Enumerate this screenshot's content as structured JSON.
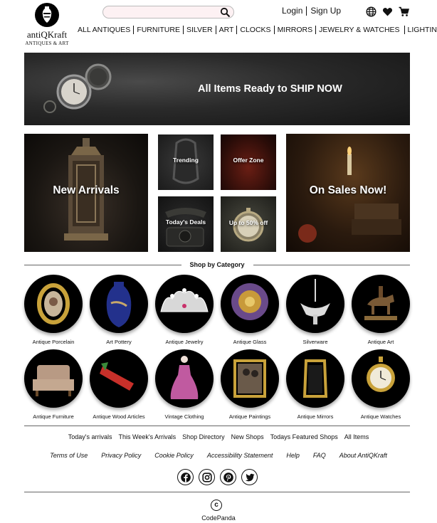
{
  "header": {
    "brand_name": "antiQKraft",
    "brand_tagline": "ANTIQUES & ART",
    "search": {
      "placeholder": "",
      "value": "",
      "icon": "search-icon"
    },
    "auth": {
      "login": "Login",
      "signup": "Sign Up"
    },
    "icons": [
      "globe-icon",
      "heart-icon",
      "cart-icon"
    ],
    "nav": [
      "ALL ANTIQUES",
      "FURNITURE",
      "SILVER",
      "ART",
      "CLOCKS",
      "MIRRORS",
      "JEWELRY & WATCHES",
      "LIGHTING"
    ]
  },
  "hero": {
    "text": "All Items Ready to SHIP NOW"
  },
  "tiles": {
    "new_arrivals": "New Arrivals",
    "trending": "Trending",
    "offer_zone": "Offer Zone",
    "todays_deals": "Today's Deals",
    "up_to_50": "Up to 50% off",
    "on_sales": "On Sales Now!"
  },
  "categories": {
    "title": "Shop by Category",
    "items": [
      "Antique Porcelain",
      "Art Pottery",
      "Antique Jewelry",
      "Antique Glass",
      "Silverware",
      "Antique Art",
      "Antique Furniture",
      "Antique Wood Articles",
      "Vintage Clothing",
      "Antique Paintings",
      "Antique Mirrors",
      "Antique Watches"
    ]
  },
  "footer": {
    "links_row1": [
      "Today's arrivals",
      "This Week's Arrivals",
      "Shop Directory",
      "New Shops",
      "Todays Featured Shops",
      "All Items"
    ],
    "links_row2": [
      "Terms of Use",
      "Privacy Policy",
      "Cookie Policy",
      "Accessibility Statement",
      "Help",
      "FAQ",
      "About AntiQKraft"
    ],
    "social": [
      "facebook-icon",
      "instagram-icon",
      "pinterest-icon",
      "twitter-icon"
    ],
    "copyright_symbol": "c",
    "brand": "CodePanda"
  }
}
